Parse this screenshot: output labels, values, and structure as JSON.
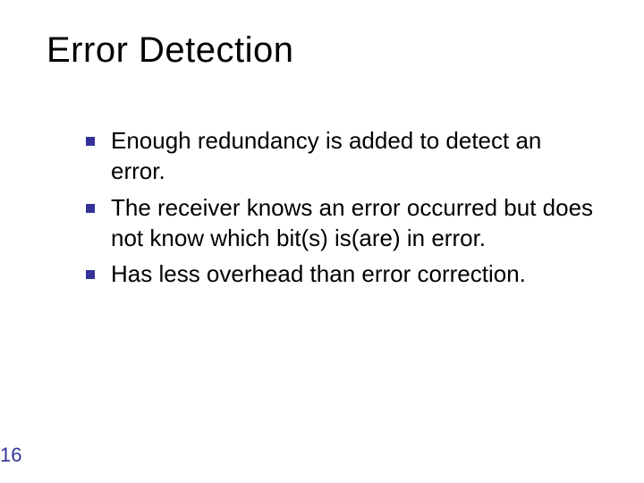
{
  "slide": {
    "title": "Error Detection",
    "bullets": [
      "Enough redundancy is added to detect an error.",
      "The receiver knows an error occurred but does not know which bit(s) is(are) in error.",
      "Has less overhead than error correction."
    ],
    "page_number": "16"
  }
}
